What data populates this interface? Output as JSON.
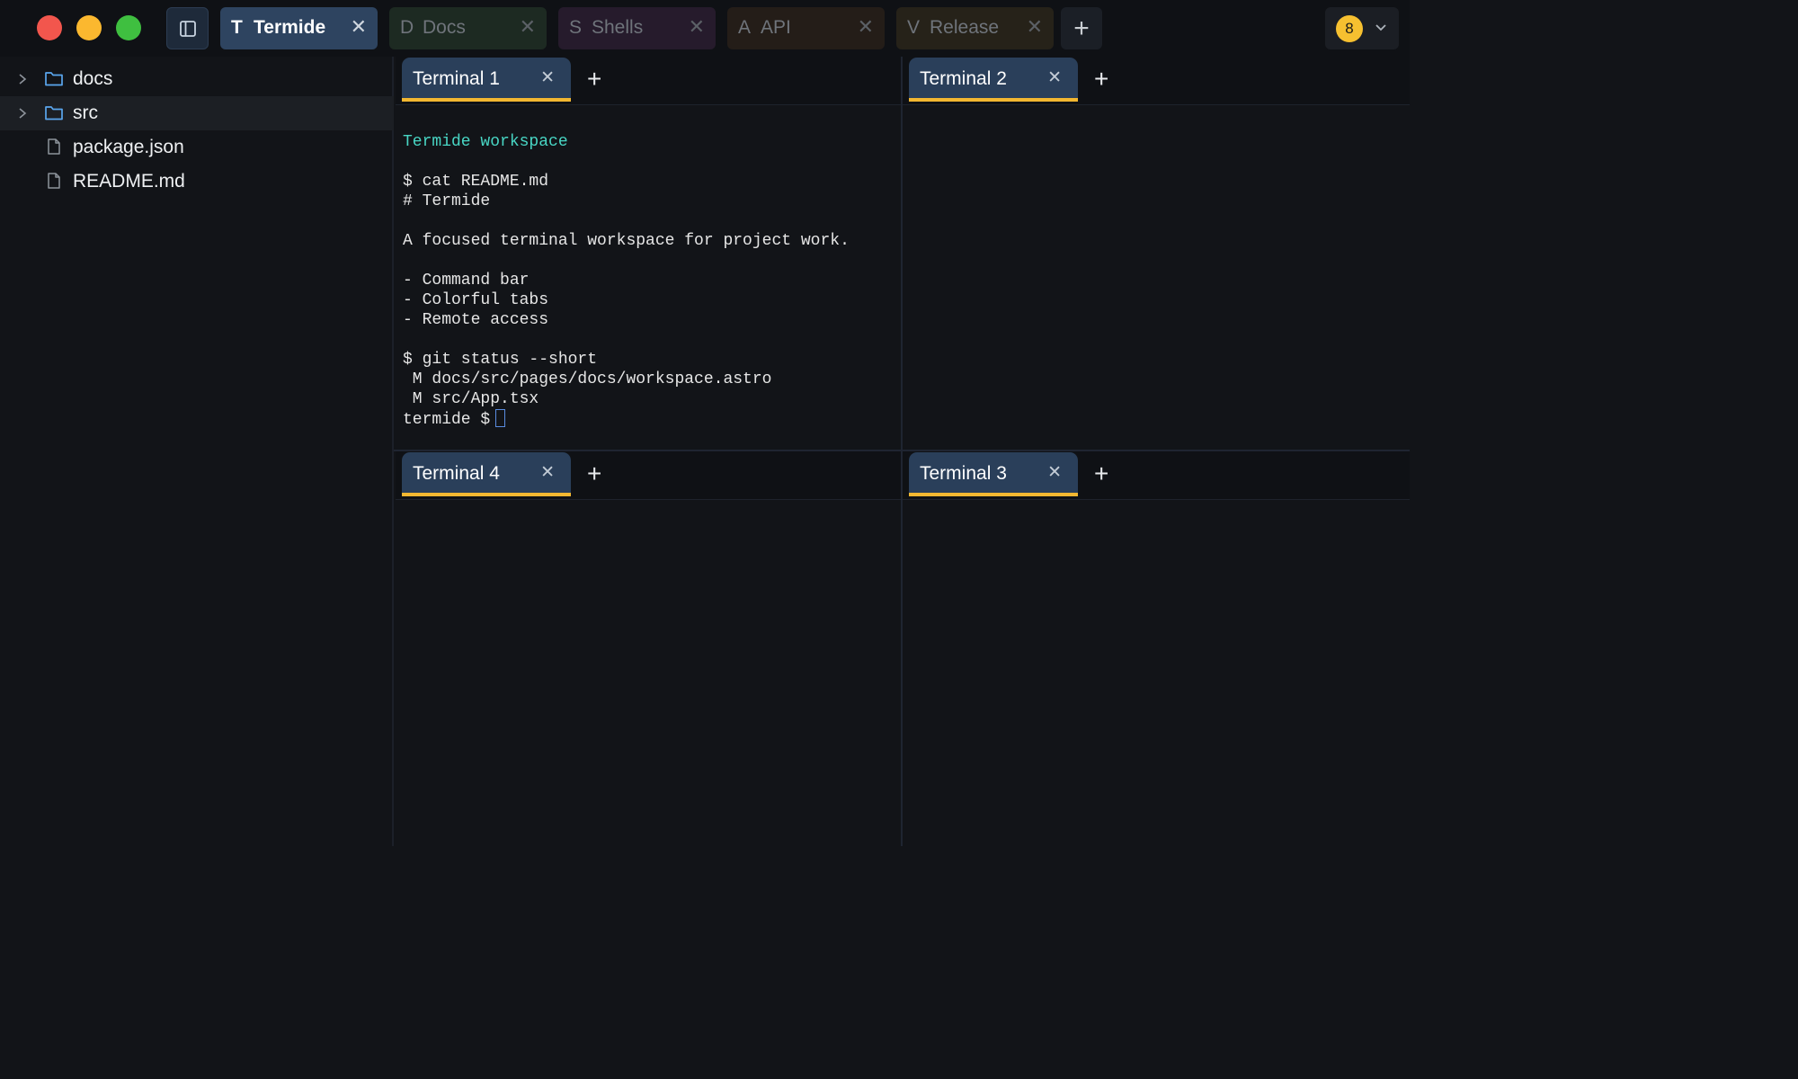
{
  "workspace_tabs": [
    {
      "letter": "T",
      "name": "Termide"
    },
    {
      "letter": "D",
      "name": "Docs"
    },
    {
      "letter": "S",
      "name": "Shells"
    },
    {
      "letter": "A",
      "name": "API"
    },
    {
      "letter": "V",
      "name": "Release"
    }
  ],
  "workspace_add": "+",
  "close_glyph": "✕",
  "notification_count": "8",
  "file_tree": [
    {
      "name": "docs",
      "type": "folder"
    },
    {
      "name": "src",
      "type": "folder"
    },
    {
      "name": "package.json",
      "type": "file"
    },
    {
      "name": "README.md",
      "type": "file"
    }
  ],
  "panes": [
    {
      "tab": "Terminal 1"
    },
    {
      "tab": "Terminal 2"
    },
    {
      "tab": "Terminal 4"
    },
    {
      "tab": "Terminal 3"
    }
  ],
  "pane_add": "+",
  "terminal1": {
    "lines": [
      "",
      "Termide workspace",
      "",
      "$ cat README.md",
      "# Termide",
      "",
      "A focused terminal workspace for project work.",
      "",
      "- Command bar",
      "- Colorful tabs",
      "- Remote access",
      "",
      "$ git status --short",
      " M docs/src/pages/docs/workspace.astro",
      " M src/App.tsx"
    ],
    "prompt": "termide $"
  },
  "colors": {
    "accent": "#f2b731",
    "active_tab": "#2e4460",
    "terminal_accent": "#48d6c4",
    "badge": "#f6c030"
  },
  "icons": {
    "sidebar_toggle": "sidebar-icon",
    "folder": "folder-icon",
    "file": "file-icon",
    "chevron": "chevron-right-icon",
    "profile_menu": "chevron-down-icon"
  }
}
